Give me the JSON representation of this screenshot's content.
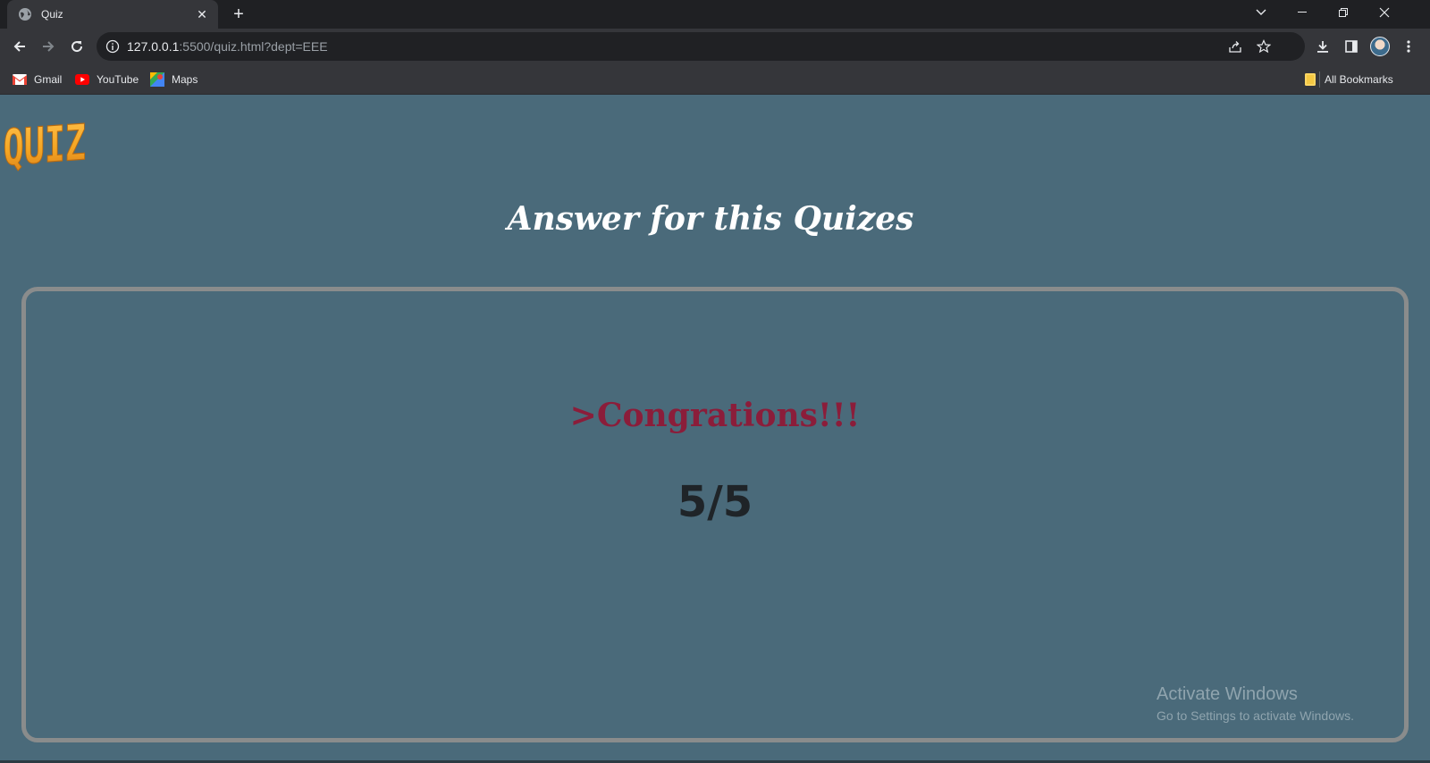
{
  "browser": {
    "tab": {
      "title": "Quiz",
      "favicon": "globe-icon"
    },
    "new_tab_icon": "plus-icon",
    "address": {
      "host": "127.0.0.1",
      "rest": ":5500/quiz.html?dept=EEE"
    },
    "bookmarks": [
      {
        "label": "Gmail",
        "icon": "gmail-icon"
      },
      {
        "label": "YouTube",
        "icon": "youtube-icon"
      },
      {
        "label": "Maps",
        "icon": "maps-icon"
      }
    ],
    "all_bookmarks_label": "All Bookmarks"
  },
  "page": {
    "logo_text": "QUIZ!",
    "heading": "Answer for this Quizes",
    "result": {
      "message": ">Congrations!!!",
      "score": "5/5"
    },
    "watermark": {
      "title": "Activate Windows",
      "subtitle": "Go to Settings to activate Windows."
    }
  },
  "colors": {
    "page_bg": "#4a6a7a",
    "heading": "#ffffff",
    "congrats": "#8b1d3a",
    "score": "#1f2428",
    "card_border": "#8a8c8c",
    "logo": "#f5a623"
  }
}
